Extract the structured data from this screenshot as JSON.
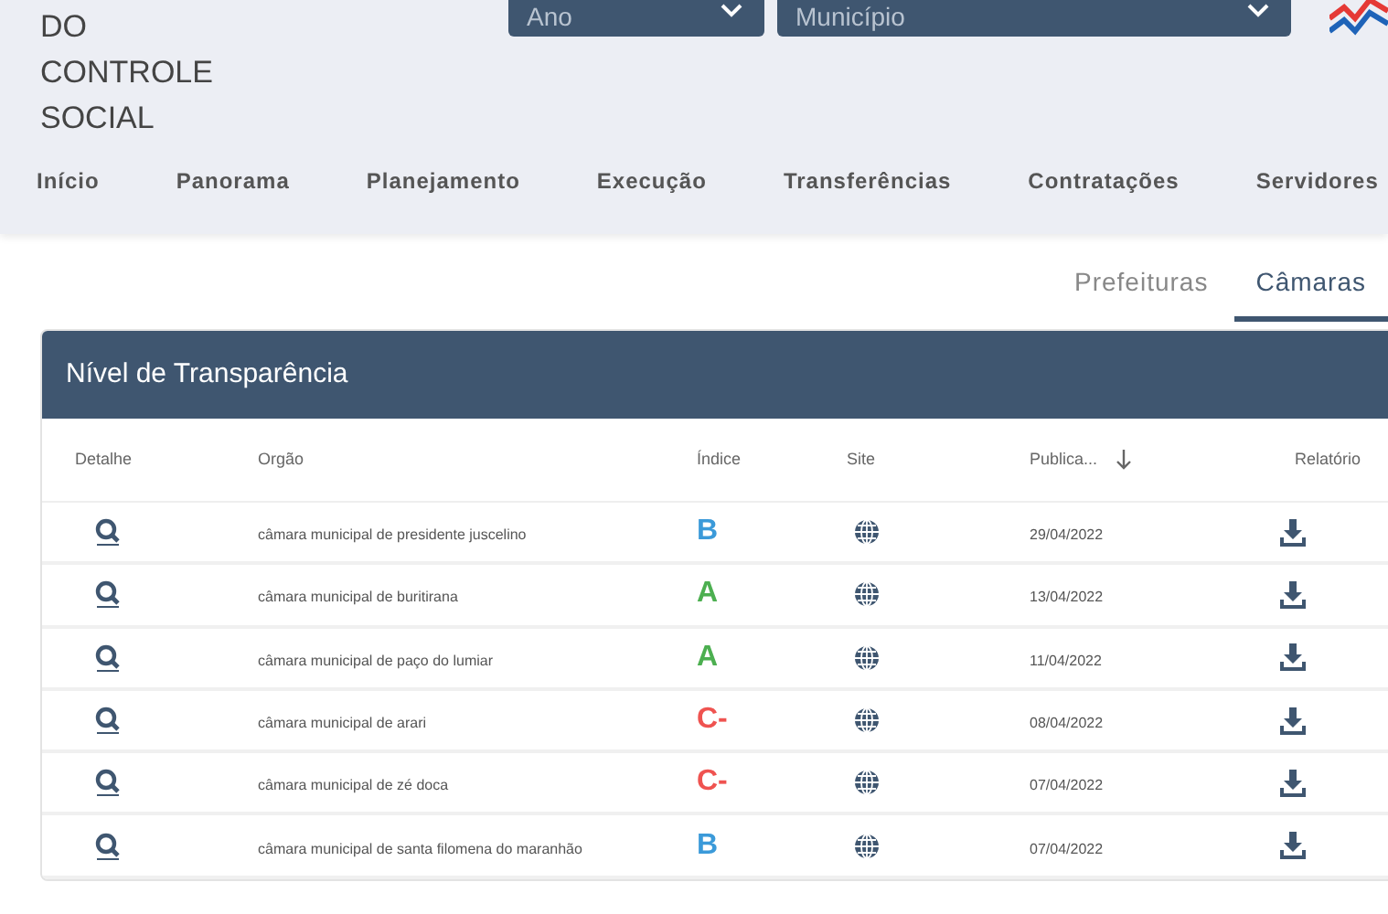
{
  "logo": {
    "lines": [
      "DO",
      "CONTROLE",
      "SOCIAL"
    ]
  },
  "filters": [
    {
      "placeholder": "Ano"
    },
    {
      "placeholder": "Município"
    }
  ],
  "nav": [
    {
      "label": "Início"
    },
    {
      "label": "Panorama"
    },
    {
      "label": "Planejamento"
    },
    {
      "label": "Execução"
    },
    {
      "label": "Transferências"
    },
    {
      "label": "Contratações"
    },
    {
      "label": "Servidores"
    }
  ],
  "tabs": [
    {
      "label": "Prefeituras",
      "selected": false
    },
    {
      "label": "Câmaras",
      "selected": true
    }
  ],
  "card": {
    "title": "Nível de Transparência"
  },
  "table": {
    "columns": [
      {
        "label": "Detalhe"
      },
      {
        "label": "Orgão"
      },
      {
        "label": "Índice"
      },
      {
        "label": "Site"
      },
      {
        "label": "Publica...",
        "sorted": true
      },
      {
        "label": "Relatório"
      }
    ],
    "rows": [
      {
        "orgao": "câmara municipal de presidente juscelino",
        "indice": "B",
        "color": "#3b9ad9",
        "data": "29/04/2022"
      },
      {
        "orgao": "câmara municipal de buritirana",
        "indice": "A",
        "color": "#4caf50",
        "data": "13/04/2022"
      },
      {
        "orgao": "câmara municipal de paço do lumiar",
        "indice": "A",
        "color": "#4caf50",
        "data": "11/04/2022"
      },
      {
        "orgao": "câmara municipal de arari",
        "indice": "C-",
        "color": "#ef5350",
        "data": "08/04/2022"
      },
      {
        "orgao": "câmara municipal de zé doca",
        "indice": "C-",
        "color": "#ef5350",
        "data": "07/04/2022"
      },
      {
        "orgao": "câmara municipal de santa filomena do maranhão",
        "indice": "B",
        "color": "#3b9ad9",
        "data": "07/04/2022"
      }
    ]
  }
}
